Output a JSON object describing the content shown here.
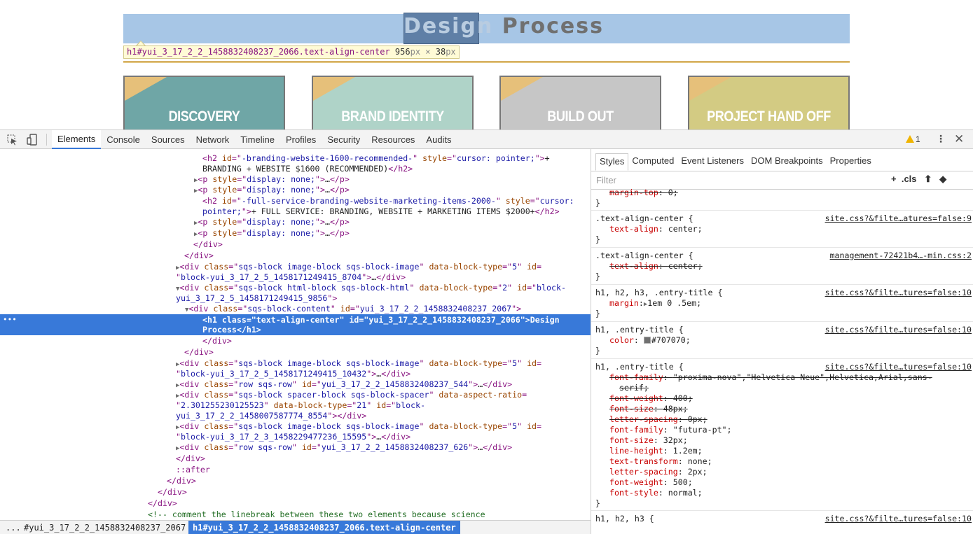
{
  "site": {
    "heading_part1": "Design",
    "heading_part2": "Process",
    "tooltip": {
      "selector": "h1#yui_3_17_2_2_1458832408237_2066.text-align-center",
      "width": "956",
      "width_unit": "px",
      "times": " × ",
      "height": "38",
      "height_unit": "px"
    },
    "cards": [
      {
        "label": "DISCOVERY",
        "color": "#6fa6a6"
      },
      {
        "label": "BRAND IDENTITY",
        "color": "#afd3c8"
      },
      {
        "label": "BUILD OUT",
        "color": "#c6c6c6"
      },
      {
        "label": "PROJECT HAND OFF",
        "color": "#d3cb83"
      }
    ]
  },
  "devtools": {
    "tabs": [
      "Elements",
      "Console",
      "Sources",
      "Network",
      "Timeline",
      "Profiles",
      "Security",
      "Resources",
      "Audits"
    ],
    "warning_count": "1",
    "sidebar_tabs": [
      "Styles",
      "Computed",
      "Event Listeners",
      "DOM Breakpoints",
      "Properties"
    ],
    "filter_placeholder": "Filter",
    "cls_label": ".cls",
    "breadcrumbs": [
      "...",
      "#yui_3_17_2_2_1458832408237_2067",
      "h1#yui_3_17_2_2_1458832408237_2066.text-align-center"
    ],
    "dom": {
      "l1": [
        "-branding-website-1600-recommended-",
        "cursor: pointer;",
        "+"
      ],
      "l2": "BRANDING + WEBSITE $1600 (RECOMMENDED)",
      "l5": [
        "-full-service-branding-website-marketing-items-2000-",
        "cursor:"
      ],
      "l6": [
        "pointer;",
        "+ FULL SERVICE: BRANDING, WEBSITE + MARKETING ITEMS $2000+"
      ],
      "display_none": "display: none;",
      "ellipsis": "…",
      "b1": [
        "sqs-block image-block sqs-block-image",
        "5",
        "block-yui_3_17_2_5_1458171249415_8704"
      ],
      "b2": [
        "sqs-block html-block sqs-block-html",
        "2",
        "block-",
        "yui_3_17_2_5_1458171249415_9856"
      ],
      "b3": [
        "sqs-block-content",
        "yui_3_17_2_2_1458832408237_2067"
      ],
      "h1": [
        "text-align-center",
        "yui_3_17_2_2_1458832408237_2066",
        "Design",
        "Process"
      ],
      "b4": [
        "sqs-block image-block sqs-block-image",
        "5",
        "block-yui_3_17_2_5_1458171249415_10432"
      ],
      "b5": [
        "row sqs-row",
        "yui_3_17_2_2_1458832408237_544"
      ],
      "b6": [
        "sqs-block spacer-block sqs-block-spacer",
        "2.301255230125523",
        "21",
        "block-",
        "yui_3_17_2_2_1458007587774_8554"
      ],
      "b7": [
        "sqs-block image-block sqs-block-image",
        "5",
        "block-yui_3_17_2_3_1458229477236_15595"
      ],
      "b8": [
        "row sqs-row",
        "yui_3_17_2_2_1458832408237_626"
      ],
      "after": "::after",
      "comment": "<!-- comment the linebreak between these two elements because science"
    },
    "styles": {
      "r0": [
        "margin-top",
        "0"
      ],
      "r1": {
        "selector": ".text-align-center {",
        "source": "site.css?&filte…atures=false:9",
        "prop": [
          "text-align",
          "center"
        ]
      },
      "r2": {
        "selector": ".text-align-center {",
        "source": "management-72421b4…-min.css:2",
        "prop": [
          "text-align",
          "center"
        ]
      },
      "r3": {
        "selector": "h1, h2, h3, .entry-title {",
        "source": "site.css?&filte…tures=false:10",
        "prop": [
          "margin",
          "1em 0 .5em"
        ]
      },
      "r4": {
        "selector": "h1, .entry-title {",
        "source": "site.css?&filte…tures=false:10",
        "prop": [
          "color",
          "#707070"
        ]
      },
      "r5": {
        "selector": "h1, .entry-title {",
        "source": "site.css?&filte…tures=false:10",
        "ff_struck": "\"proxima-nova\",\"Helvetica Neue\",Helvetica,Arial,sans-",
        "ff_struck2": "serif",
        "struck": [
          [
            "font-weight",
            "400"
          ],
          [
            "font-size",
            "48px"
          ],
          [
            "letter-spacing",
            "0px"
          ]
        ],
        "props": [
          [
            "font-family",
            "\"futura-pt\""
          ],
          [
            "font-size",
            "32px"
          ],
          [
            "line-height",
            "1.2em"
          ],
          [
            "text-transform",
            "none"
          ],
          [
            "letter-spacing",
            "2px"
          ],
          [
            "font-weight",
            "500"
          ],
          [
            "font-style",
            "normal"
          ]
        ]
      },
      "r6": {
        "selector": "h1, h2, h3 {",
        "source": "site.css?&filte…tures=false:10"
      }
    }
  }
}
